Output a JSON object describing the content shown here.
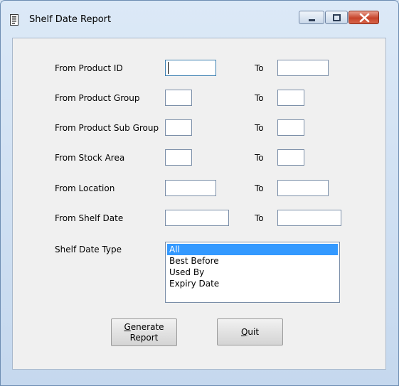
{
  "window": {
    "title": "Shelf Date Report",
    "icon": "document-icon"
  },
  "form": {
    "rows": [
      {
        "label": "From Product ID",
        "from_value": "",
        "to_label": "To",
        "to_value": ""
      },
      {
        "label": "From Product Group",
        "from_value": "",
        "to_label": "To",
        "to_value": ""
      },
      {
        "label": "From Product Sub Group",
        "from_value": "",
        "to_label": "To",
        "to_value": ""
      },
      {
        "label": "From Stock Area",
        "from_value": "",
        "to_label": "To",
        "to_value": ""
      },
      {
        "label": "From Location",
        "from_value": "",
        "to_label": "To",
        "to_value": ""
      },
      {
        "label": "From Shelf Date",
        "from_value": "",
        "to_label": "To",
        "to_value": ""
      }
    ],
    "shelf_date_type": {
      "label": "Shelf Date Type",
      "options": [
        "All",
        "Best Before",
        "Used By",
        "Expiry Date"
      ],
      "selected": "All"
    }
  },
  "buttons": {
    "generate": {
      "mnemonic": "G",
      "rest_line1": "enerate",
      "line2": "Report"
    },
    "quit": {
      "mnemonic": "Q",
      "rest": "uit"
    }
  },
  "colors": {
    "selection": "#3399ff",
    "close_button": "#c6432b",
    "window_frame": "#c5d8ee"
  }
}
